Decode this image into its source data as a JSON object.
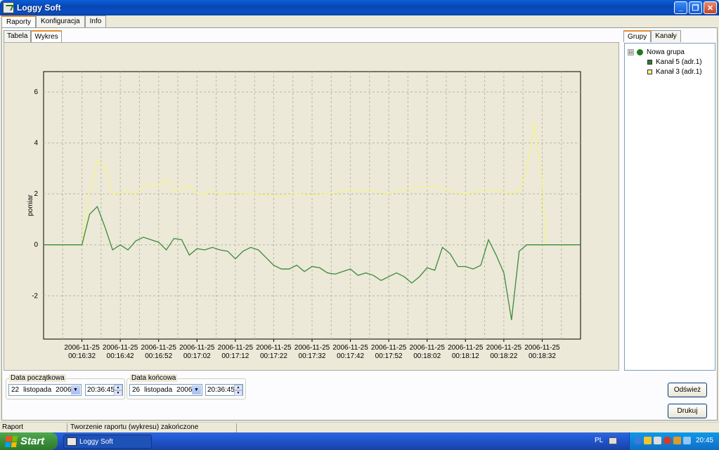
{
  "window": {
    "title": "Loggy Soft"
  },
  "main_tabs": [
    {
      "label": "Raporty",
      "active": true
    },
    {
      "label": "Konfiguracja",
      "active": false
    },
    {
      "label": "Info",
      "active": false
    }
  ],
  "sub_tabs": [
    {
      "label": "Tabela",
      "active": false
    },
    {
      "label": "Wykres",
      "active": true
    }
  ],
  "right_tabs": [
    {
      "label": "Grupy",
      "active": true
    },
    {
      "label": "Kanały",
      "active": false
    }
  ],
  "tree": {
    "group": {
      "label": "Nowa grupa",
      "color": "#1f7a1f",
      "expander": "⊟"
    },
    "channels": [
      {
        "label": "Kanał 5 (adr.1)",
        "color": "#2e7d2e"
      },
      {
        "label": "Kanał 3 (adr.1)",
        "color": "#f2f27a"
      }
    ]
  },
  "chart_data": {
    "type": "line",
    "ylabel": "pomiar",
    "xlabel": "",
    "ylim": [
      -3.7,
      6.8
    ],
    "yticks": [
      -2,
      0,
      2,
      4,
      6
    ],
    "grid": true,
    "x_ticks": [
      {
        "date": "2006-11-25",
        "time": "00:16:32"
      },
      {
        "date": "2006-11-25",
        "time": "00:16:42"
      },
      {
        "date": "2006-11-25",
        "time": "00:16:52"
      },
      {
        "date": "2006-11-25",
        "time": "00:17:02"
      },
      {
        "date": "2006-11-25",
        "time": "00:17:12"
      },
      {
        "date": "2006-11-25",
        "time": "00:17:22"
      },
      {
        "date": "2006-11-25",
        "time": "00:17:32"
      },
      {
        "date": "2006-11-25",
        "time": "00:17:42"
      },
      {
        "date": "2006-11-25",
        "time": "00:17:52"
      },
      {
        "date": "2006-11-25",
        "time": "00:18:02"
      },
      {
        "date": "2006-11-25",
        "time": "00:18:12"
      },
      {
        "date": "2006-11-25",
        "time": "00:18:22"
      },
      {
        "date": "2006-11-25",
        "time": "00:18:32"
      }
    ],
    "xlim_seconds": [
      -10,
      130
    ],
    "series": [
      {
        "color": "#f3f38c",
        "points": [
          [
            -10,
            0
          ],
          [
            0,
            0
          ],
          [
            2,
            2.0
          ],
          [
            4,
            3.3
          ],
          [
            6,
            3.1
          ],
          [
            8,
            2.0
          ],
          [
            10,
            2.05
          ],
          [
            12,
            2.1
          ],
          [
            14,
            2.0
          ],
          [
            16,
            2.3
          ],
          [
            18,
            2.4
          ],
          [
            20,
            2.3
          ],
          [
            22,
            2.6
          ],
          [
            24,
            2.1
          ],
          [
            26,
            2.2
          ],
          [
            28,
            2.3
          ],
          [
            30,
            2.0
          ],
          [
            32,
            2.0
          ],
          [
            34,
            2.1
          ],
          [
            36,
            2.0
          ],
          [
            40,
            2.05
          ],
          [
            44,
            2.0
          ],
          [
            48,
            1.95
          ],
          [
            52,
            1.9
          ],
          [
            56,
            2.0
          ],
          [
            60,
            1.95
          ],
          [
            64,
            2.0
          ],
          [
            68,
            2.1
          ],
          [
            72,
            2.15
          ],
          [
            76,
            2.1
          ],
          [
            80,
            2.0
          ],
          [
            84,
            2.2
          ],
          [
            88,
            2.25
          ],
          [
            92,
            2.3
          ],
          [
            96,
            2.1
          ],
          [
            100,
            2.0
          ],
          [
            104,
            2.1
          ],
          [
            108,
            2.1
          ],
          [
            112,
            2.05
          ],
          [
            114,
            2.1
          ],
          [
            116,
            3.0
          ],
          [
            118,
            4.8
          ],
          [
            120,
            2.5
          ],
          [
            121,
            0
          ],
          [
            124,
            0
          ],
          [
            130,
            0
          ]
        ]
      },
      {
        "color": "#3b8a3b",
        "points": [
          [
            -10,
            0
          ],
          [
            0,
            0
          ],
          [
            2,
            1.2
          ],
          [
            4,
            1.5
          ],
          [
            6,
            0.7
          ],
          [
            8,
            -0.2
          ],
          [
            10,
            0.0
          ],
          [
            12,
            -0.2
          ],
          [
            14,
            0.15
          ],
          [
            16,
            0.3
          ],
          [
            18,
            0.2
          ],
          [
            20,
            0.1
          ],
          [
            22,
            -0.2
          ],
          [
            24,
            0.25
          ],
          [
            26,
            0.2
          ],
          [
            28,
            -0.4
          ],
          [
            30,
            -0.15
          ],
          [
            32,
            -0.2
          ],
          [
            34,
            -0.1
          ],
          [
            36,
            -0.2
          ],
          [
            38,
            -0.25
          ],
          [
            40,
            -0.55
          ],
          [
            42,
            -0.25
          ],
          [
            44,
            -0.1
          ],
          [
            46,
            -0.2
          ],
          [
            48,
            -0.5
          ],
          [
            50,
            -0.8
          ],
          [
            52,
            -0.95
          ],
          [
            54,
            -0.95
          ],
          [
            56,
            -0.8
          ],
          [
            58,
            -1.05
          ],
          [
            60,
            -0.85
          ],
          [
            62,
            -0.9
          ],
          [
            64,
            -1.1
          ],
          [
            66,
            -1.15
          ],
          [
            68,
            -1.05
          ],
          [
            70,
            -0.95
          ],
          [
            72,
            -1.2
          ],
          [
            74,
            -1.1
          ],
          [
            76,
            -1.2
          ],
          [
            78,
            -1.4
          ],
          [
            80,
            -1.25
          ],
          [
            82,
            -1.1
          ],
          [
            84,
            -1.25
          ],
          [
            86,
            -1.5
          ],
          [
            88,
            -1.25
          ],
          [
            90,
            -0.9
          ],
          [
            92,
            -1.0
          ],
          [
            94,
            -0.1
          ],
          [
            96,
            -0.35
          ],
          [
            98,
            -0.85
          ],
          [
            100,
            -0.85
          ],
          [
            102,
            -0.95
          ],
          [
            104,
            -0.8
          ],
          [
            106,
            0.2
          ],
          [
            108,
            -0.4
          ],
          [
            110,
            -1.1
          ],
          [
            112,
            -2.95
          ],
          [
            114,
            -0.25
          ],
          [
            116,
            0.0
          ],
          [
            120,
            0
          ],
          [
            130,
            0
          ]
        ]
      }
    ]
  },
  "controls": {
    "start_date": {
      "label": "Data początkowa",
      "day": "22",
      "month": "listopada",
      "year": "2006",
      "time": "20:36:45"
    },
    "end_date": {
      "label": "Data końcowa",
      "day": "26",
      "month": "listopada",
      "year": "2006",
      "time": "20:36:45"
    },
    "refresh_label": "Odśwież",
    "print_label": "Drukuj"
  },
  "status": {
    "left": "Raport",
    "message": "Tworzenie raportu (wykresu) zakończone"
  },
  "taskbar": {
    "start_label": "Start",
    "app_label": "Loggy Soft",
    "lang": "PL",
    "clock": "20:45"
  },
  "colors": {
    "plot_bg": "#ece9d8",
    "grid": "#b8b8a8"
  }
}
